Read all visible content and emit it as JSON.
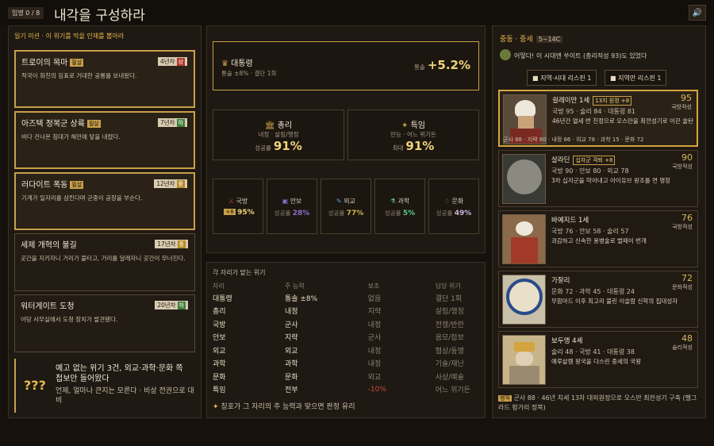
{
  "header": {
    "round": "임명 0 / 8",
    "title": "내각을 구성하라",
    "sound_icon": "speaker-icon"
  },
  "left": {
    "section_title": "일기 미션 · 이 위기를 막을 인재를 뽑아라",
    "missions": [
      {
        "title": "트로이의 목마",
        "tag": "필살",
        "years": "4년차",
        "diff": "상",
        "desc": "적국이 화친의 징표로 거대한 공룡를 보내왔다."
      },
      {
        "title": "아즈텍 정복군 상륙",
        "tag": "필살",
        "years": "7년차",
        "diff": "하",
        "desc": "바다 건너온 침대가 해안에 닿을 내렸다."
      },
      {
        "title": "러다이트 폭동",
        "tag": "필살",
        "years": "12년차",
        "diff": "중",
        "desc": "기계가 일자리를 삼킨다며 군중이 공장을 부순다."
      },
      {
        "title": "세제 개혁의 불길",
        "tag": "",
        "years": "17년차",
        "diff": "중",
        "desc": "곳간을 지키자니 거리가 불타고, 거리를 달래자니 곳간이 무너진다."
      },
      {
        "title": "워터게이트 도청",
        "tag": "",
        "years": "20년차",
        "diff": "하",
        "desc": "야당 사무실에서 도청 장치가 발견됐다."
      }
    ],
    "mystery": {
      "marks": "???",
      "line1": "예고 없는 위기 3건, 외교·과학·문화 쪽 첩보만 들어왔다",
      "line2": "언제, 얼마나 큰지는 모른다 · 비상 전권으로 대비"
    }
  },
  "middle": {
    "pm": {
      "label": "대통령",
      "sub": "통솔 ±8% · 결단 1회",
      "bonus_label": "통솔",
      "bonus": "+5.2%"
    },
    "chief": {
      "label": "총리",
      "sub": "내정 · 살림/행정",
      "rate_label": "성공률",
      "rate": "91%"
    },
    "special": {
      "label": "특임",
      "sub": "만능 · 어느 위기든",
      "rate_label": "최대",
      "rate": "91%"
    },
    "stats": [
      {
        "label": "국방",
        "badge": "+8",
        "rate": "95%"
      },
      {
        "label": "안보",
        "rate_label": "성공률",
        "rate": "28%"
      },
      {
        "label": "외교",
        "rate_label": "성공률",
        "rate": "77%"
      },
      {
        "label": "과학",
        "rate_label": "성공률",
        "rate": "5%"
      },
      {
        "label": "문화",
        "rate_label": "성공률",
        "rate": "49%"
      }
    ],
    "table_title": "각 자리가 맡는 위기",
    "table_headers": [
      "자리",
      "주 능력",
      "보조",
      "담당 위기"
    ],
    "table_rows": [
      [
        "대통령",
        "통솔 ±8%",
        "없음",
        "결단 1회"
      ],
      [
        "총리",
        "내정",
        "지략",
        "살림/행정"
      ],
      [
        "국방",
        "군사",
        "내정",
        "전쟁/반란"
      ],
      [
        "안보",
        "지략",
        "군사",
        "음모/첩보"
      ],
      [
        "외교",
        "외교",
        "내정",
        "협상/동맹"
      ],
      [
        "과학",
        "과학",
        "내정",
        "기술/재난"
      ],
      [
        "문화",
        "문화",
        "외교",
        "사상/예술"
      ],
      [
        "특임",
        "전부",
        "-10%",
        "어느 위기든"
      ]
    ],
    "tip": "칭호가 그 자리의 주 능력과 맞으면 판정 유리"
  },
  "right": {
    "era": "중동 · 중세",
    "era_range": "5~14C",
    "advisor": "어떻다! 이 시대엔 쑤이트 (총리적성 93)도 있었다",
    "reroll1": "지역·시대 리스핀 1",
    "reroll2": "지역만 리스핀 1",
    "candidates": [
      {
        "name": "쉴레이만 1세",
        "trait": "13지 원정 +8",
        "power": "95",
        "power_label": "국방적성",
        "stats": "국방 95 · 술리 84 · 대통령 81",
        "desc": "46년간 열세 번 친정으로 오스만을 최전성기로 이끈 술탄",
        "mini": "군사 88 · 지략 80 · 내정 86 · 외교 78 · 과학 15 · 문화 72"
      },
      {
        "name": "살라딘",
        "trait": "십자군 격퇴 +8",
        "power": "90",
        "power_label": "국방적성",
        "stats": "국방 90 · 안보 80 · 외교 78",
        "desc": "3차 십자군을 막아내고 아이유브 왕조를 연 명장"
      },
      {
        "name": "바예지드 1세",
        "trait": "",
        "power": "76",
        "power_label": "국방적성",
        "stats": "국방 76 · 안보 58 · 술리 57",
        "desc": "과감하고 신속한 용병술로 벌떼이 번개"
      },
      {
        "name": "가잘리",
        "trait": "",
        "power": "72",
        "power_label": "문화적성",
        "stats": "문화 72 · 과학 45 · 대통령 24",
        "desc": "무함마드 이후 최고리 불린 이슬람 신학의 집대성자"
      },
      {
        "name": "보두앵 4세",
        "trait": "",
        "power": "48",
        "power_label": "술리적성",
        "stats": "술리 48 · 국방 41 · 대통령 38",
        "desc": "예루살렘 왕국을 다스린 중세의 국왕"
      }
    ],
    "footnote_badge": "행적",
    "footnote": "군사 88 · 46년 치세 13차 대외원정으로 오스만 최전성기 구축 (벨그라드 헝가리 정복)"
  }
}
